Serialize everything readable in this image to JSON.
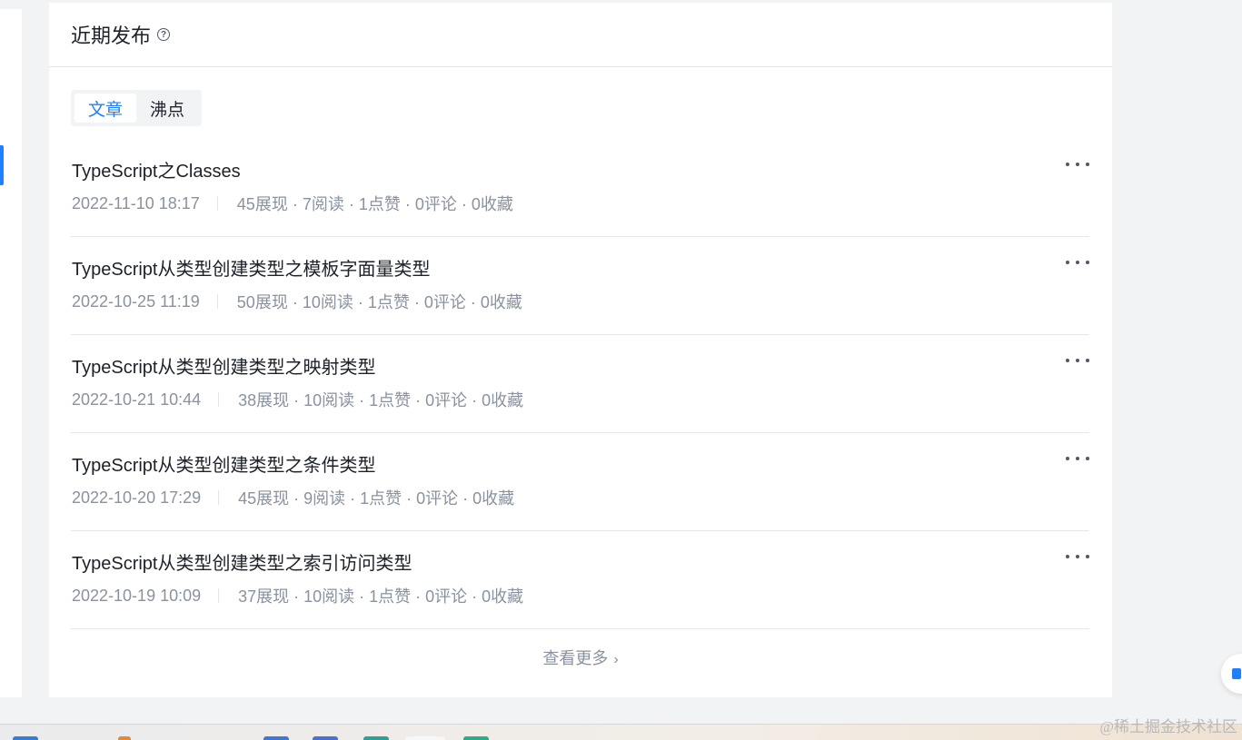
{
  "section": {
    "title": "近期发布",
    "help_icon": "question-circle-icon"
  },
  "tabs": [
    {
      "label": "文章",
      "active": true
    },
    {
      "label": "沸点",
      "active": false
    }
  ],
  "articles": [
    {
      "title": "TypeScript之Classes",
      "datetime": "2022-11-10 18:17",
      "stats": "45展现 · 7阅读 · 1点赞 · 0评论 · 0收藏"
    },
    {
      "title": "TypeScript从类型创建类型之模板字面量类型",
      "datetime": "2022-10-25 11:19",
      "stats": "50展现 · 10阅读 · 1点赞 · 0评论 · 0收藏"
    },
    {
      "title": "TypeScript从类型创建类型之映射类型",
      "datetime": "2022-10-21 10:44",
      "stats": "38展现 · 10阅读 · 1点赞 · 0评论 · 0收藏"
    },
    {
      "title": "TypeScript从类型创建类型之条件类型",
      "datetime": "2022-10-20 17:29",
      "stats": "45展现 · 9阅读 · 1点赞 · 0评论 · 0收藏"
    },
    {
      "title": "TypeScript从类型创建类型之索引访问类型",
      "datetime": "2022-10-19 10:09",
      "stats": "37展现 · 10阅读 · 1点赞 · 0评论 · 0收藏"
    }
  ],
  "more_icon": "more-horizontal-icon",
  "view_more": {
    "label": "查看更多",
    "icon": "chevron-right-icon"
  },
  "watermark": "@稀土掘金技术社区",
  "colors": {
    "accent": "#1e80ff",
    "text": "#1d2129",
    "muted": "#8a919f"
  }
}
